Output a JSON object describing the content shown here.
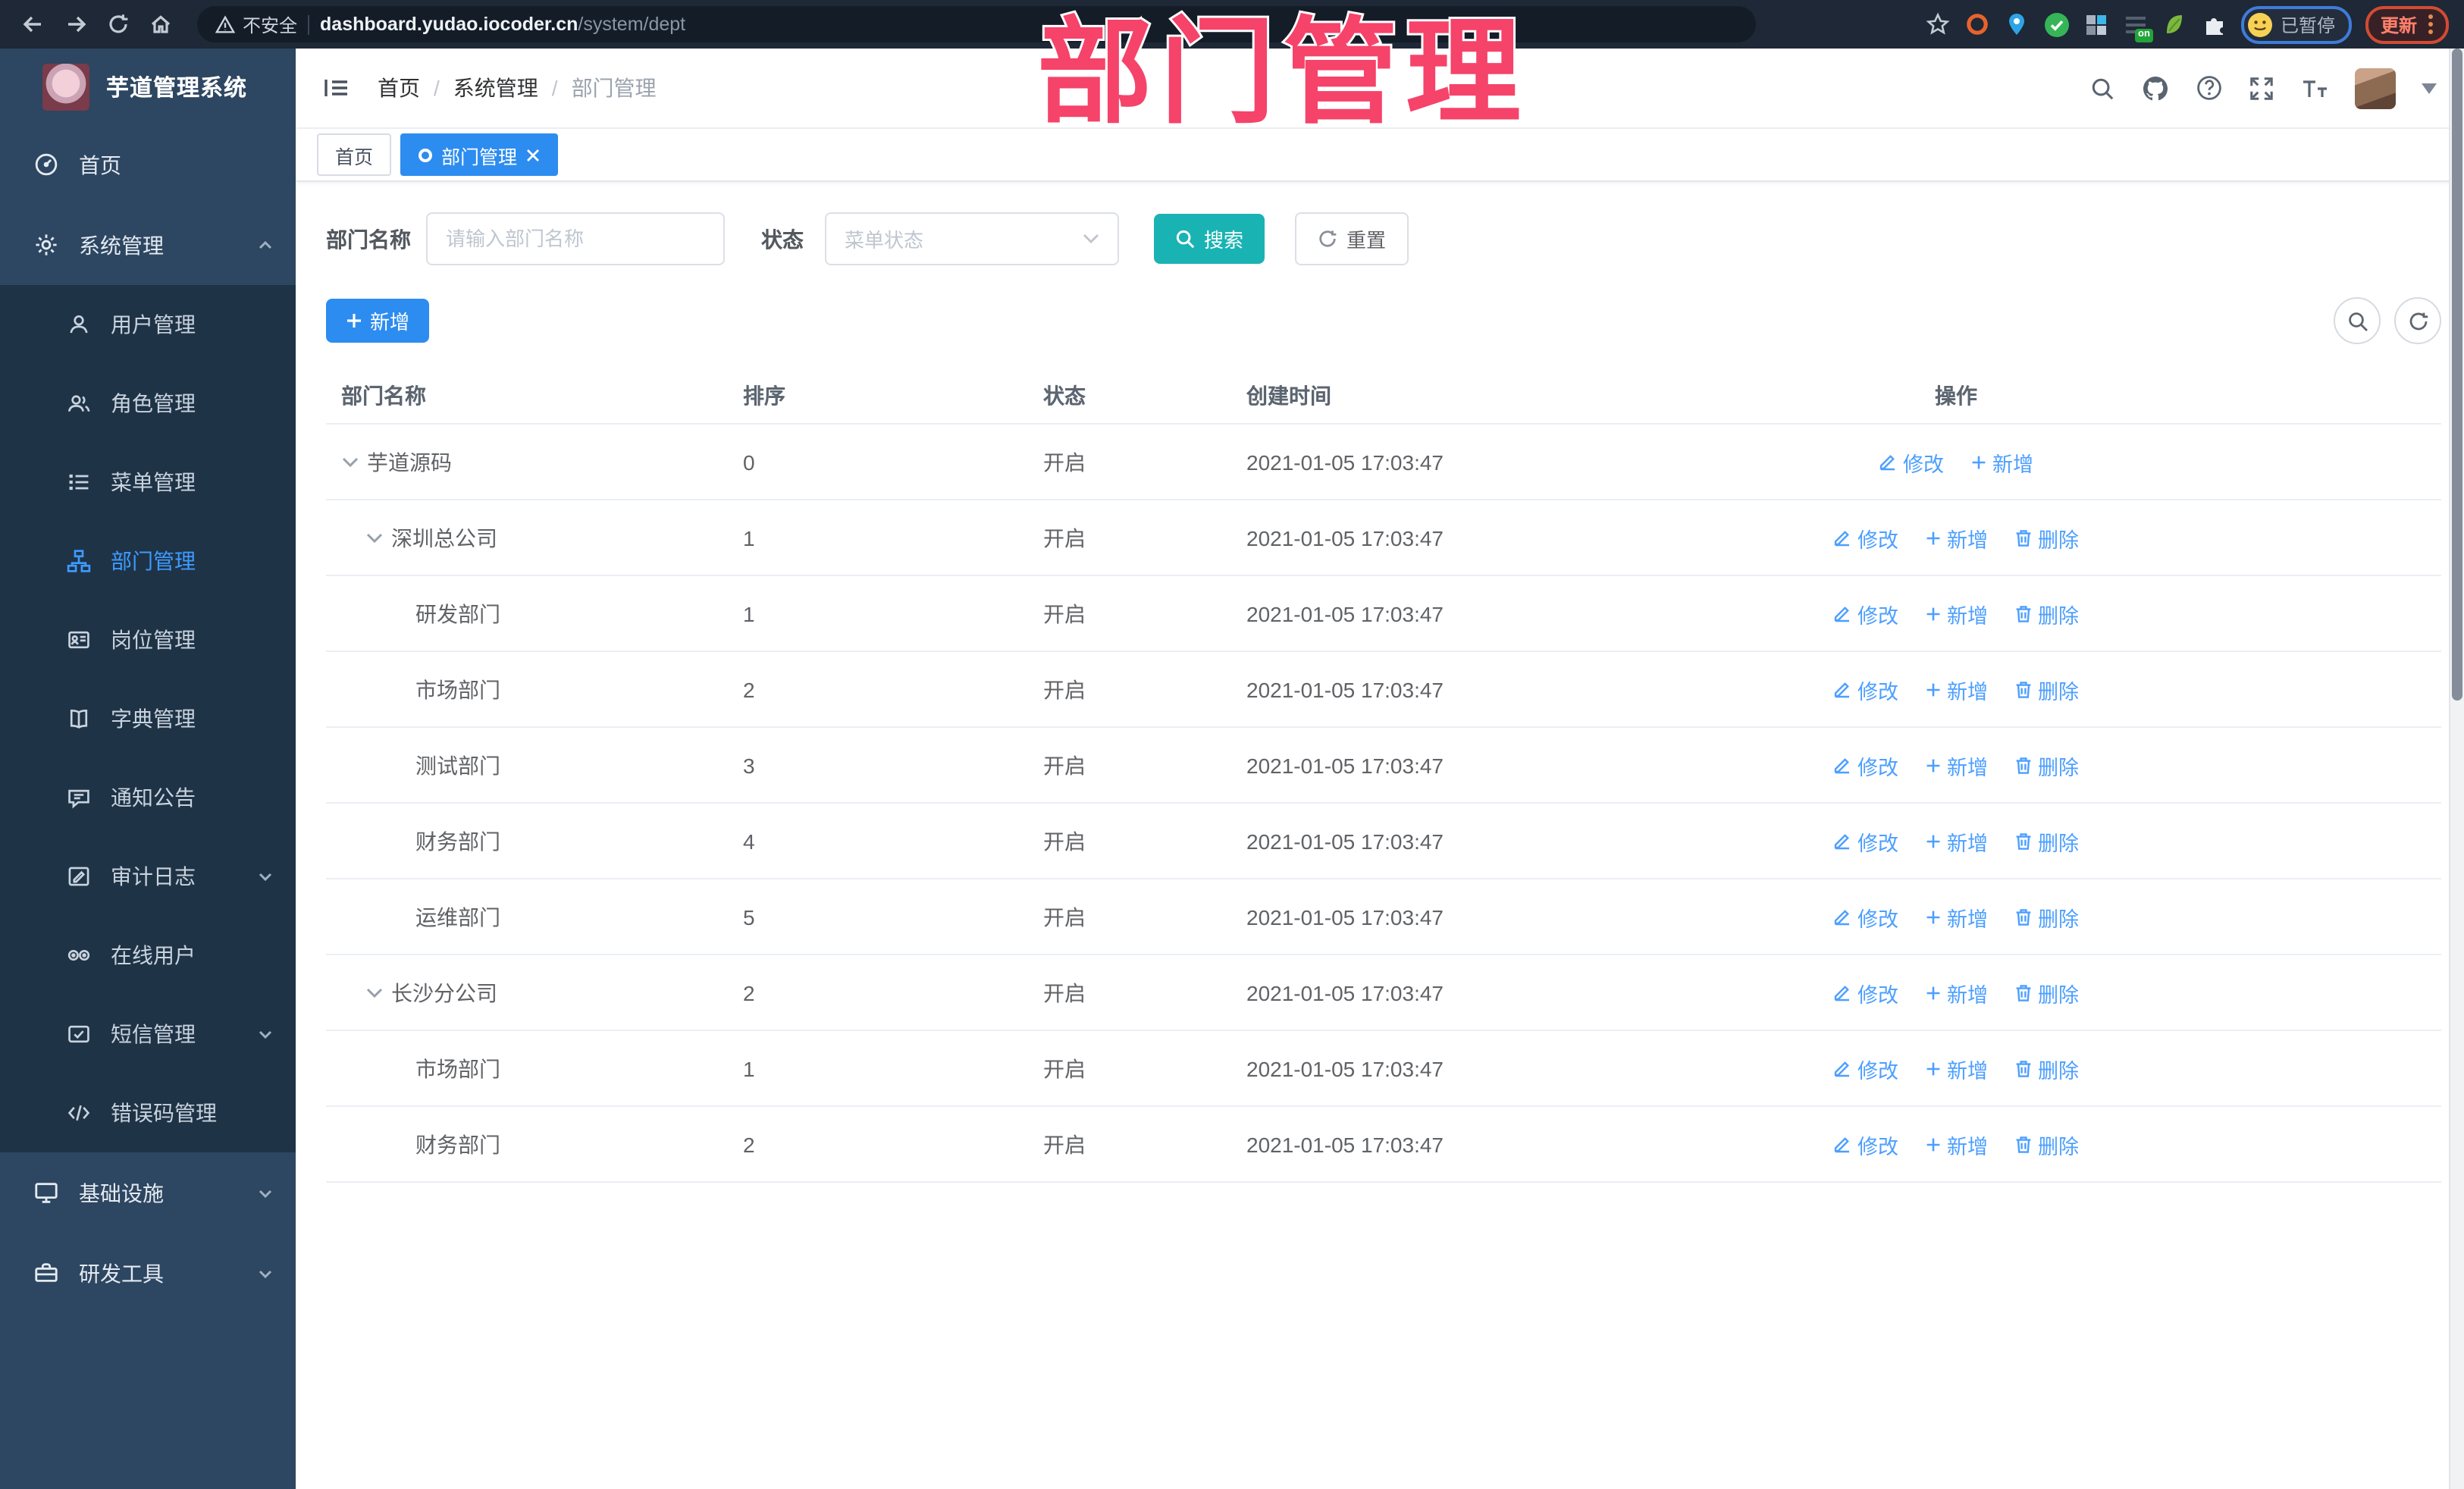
{
  "browser": {
    "security_label": "不安全",
    "url_host": "dashboard.yudao.iocoder.cn",
    "url_path": "/system/dept",
    "ext_on_badge": "on",
    "paused_badge": "已暂停",
    "update_button": "更新"
  },
  "annotation": {
    "text": "部门管理",
    "color": "#f5436a"
  },
  "sidebar": {
    "app_title": "芋道管理系统",
    "items": [
      {
        "label": "首页"
      },
      {
        "label": "系统管理",
        "state": "expanded"
      },
      {
        "label": "用户管理"
      },
      {
        "label": "角色管理"
      },
      {
        "label": "菜单管理"
      },
      {
        "label": "部门管理",
        "active": true
      },
      {
        "label": "岗位管理"
      },
      {
        "label": "字典管理"
      },
      {
        "label": "通知公告"
      },
      {
        "label": "审计日志",
        "state": "collapsed"
      },
      {
        "label": "在线用户"
      },
      {
        "label": "短信管理",
        "state": "collapsed"
      },
      {
        "label": "错误码管理"
      },
      {
        "label": "基础设施",
        "state": "collapsed"
      },
      {
        "label": "研发工具",
        "state": "collapsed"
      }
    ]
  },
  "header": {
    "breadcrumb": [
      "首页",
      "系统管理",
      "部门管理"
    ],
    "breadcrumb_separator": "/"
  },
  "tabs": [
    {
      "label": "首页",
      "active": false
    },
    {
      "label": "部门管理",
      "active": true
    }
  ],
  "filters": {
    "dept_name_label": "部门名称",
    "dept_name_placeholder": "请输入部门名称",
    "status_label": "状态",
    "status_placeholder": "菜单状态",
    "search_label": "搜索",
    "reset_label": "重置"
  },
  "toolbar": {
    "add_label": "新增"
  },
  "table": {
    "headers": [
      "部门名称",
      "排序",
      "状态",
      "创建时间",
      "操作"
    ],
    "rows": [
      {
        "name": "芋道源码",
        "level": 0,
        "expandable": true,
        "sort": "0",
        "status": "开启",
        "created": "2021-01-05 17:03:47",
        "actions": [
          "修改",
          "新增"
        ]
      },
      {
        "name": "深圳总公司",
        "level": 1,
        "expandable": true,
        "sort": "1",
        "status": "开启",
        "created": "2021-01-05 17:03:47",
        "actions": [
          "修改",
          "新增",
          "删除"
        ]
      },
      {
        "name": "研发部门",
        "level": 2,
        "expandable": false,
        "sort": "1",
        "status": "开启",
        "created": "2021-01-05 17:03:47",
        "actions": [
          "修改",
          "新增",
          "删除"
        ]
      },
      {
        "name": "市场部门",
        "level": 2,
        "expandable": false,
        "sort": "2",
        "status": "开启",
        "created": "2021-01-05 17:03:47",
        "actions": [
          "修改",
          "新增",
          "删除"
        ]
      },
      {
        "name": "测试部门",
        "level": 2,
        "expandable": false,
        "sort": "3",
        "status": "开启",
        "created": "2021-01-05 17:03:47",
        "actions": [
          "修改",
          "新增",
          "删除"
        ]
      },
      {
        "name": "财务部门",
        "level": 2,
        "expandable": false,
        "sort": "4",
        "status": "开启",
        "created": "2021-01-05 17:03:47",
        "actions": [
          "修改",
          "新增",
          "删除"
        ]
      },
      {
        "name": "运维部门",
        "level": 2,
        "expandable": false,
        "sort": "5",
        "status": "开启",
        "created": "2021-01-05 17:03:47",
        "actions": [
          "修改",
          "新增",
          "删除"
        ]
      },
      {
        "name": "长沙分公司",
        "level": 1,
        "expandable": true,
        "sort": "2",
        "status": "开启",
        "created": "2021-01-05 17:03:47",
        "actions": [
          "修改",
          "新增",
          "删除"
        ]
      },
      {
        "name": "市场部门",
        "level": 2,
        "expandable": false,
        "sort": "1",
        "status": "开启",
        "created": "2021-01-05 17:03:47",
        "actions": [
          "修改",
          "新增",
          "删除"
        ]
      },
      {
        "name": "财务部门",
        "level": 2,
        "expandable": false,
        "sort": "2",
        "status": "开启",
        "created": "2021-01-05 17:03:47",
        "actions": [
          "修改",
          "新增",
          "删除"
        ]
      }
    ]
  },
  "colors": {
    "primary": "#2d8cf0",
    "link": "#4c9fff",
    "search_button": "#1ab3b3",
    "sidebar_bg": "#2d4661",
    "submenu_bg": "#1f3347",
    "annotation_pink": "#f5436a",
    "browser_bar_bg": "#1e2836"
  }
}
